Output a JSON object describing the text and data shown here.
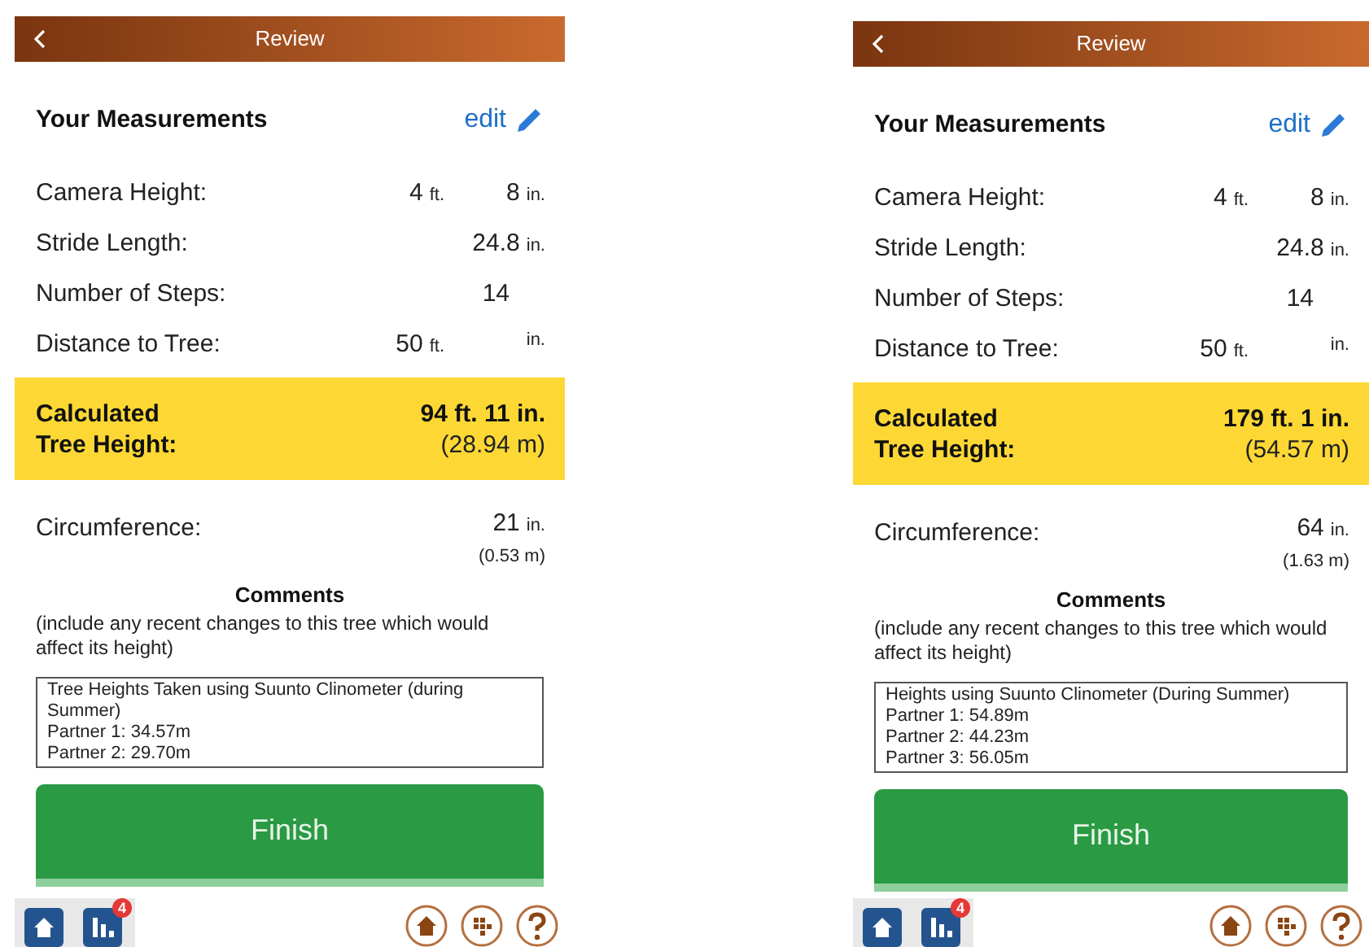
{
  "screens": [
    {
      "title": "Review",
      "heading": "Your Measurements",
      "edit_label": "edit",
      "measurements": [
        {
          "label": "Camera Height:",
          "values": [
            {
              "number": "4",
              "unit": "ft."
            },
            {
              "number": "8",
              "unit": "in."
            }
          ]
        },
        {
          "label": "Stride Length:",
          "values": [
            {
              "number": "24.8",
              "unit": "in."
            }
          ]
        },
        {
          "label": "Number of Steps:",
          "values": [
            {
              "number": "14"
            }
          ]
        },
        {
          "label": "Distance to Tree:",
          "values": [
            {
              "number": "50",
              "unit": "ft."
            },
            {
              "unit": "in."
            }
          ]
        }
      ],
      "calculated": {
        "label": "Calculated Tree Height:",
        "imperial": "94 ft. 11 in.",
        "metric": "(28.94 m)"
      },
      "circumference": {
        "label": "Circumference:",
        "number": "21",
        "unit": "in.",
        "metric": "(0.53 m)"
      },
      "comments": {
        "title": "Comments",
        "hint": "(include any recent changes to this tree which would affect its height)",
        "lines": [
          "Tree Heights Taken using Suunto Clinometer (during Summer)",
          "Partner 1: 34.57m",
          "Partner 2: 29.70m"
        ]
      },
      "finish_label": "Finish",
      "badge": "4"
    },
    {
      "title": "Review",
      "heading": "Your Measurements",
      "edit_label": "edit",
      "measurements": [
        {
          "label": "Camera Height:",
          "values": [
            {
              "number": "4",
              "unit": "ft."
            },
            {
              "number": "8",
              "unit": "in."
            }
          ]
        },
        {
          "label": "Stride Length:",
          "values": [
            {
              "number": "24.8",
              "unit": "in."
            }
          ]
        },
        {
          "label": "Number of Steps:",
          "values": [
            {
              "number": "14"
            }
          ]
        },
        {
          "label": "Distance to Tree:",
          "values": [
            {
              "number": "50",
              "unit": "ft."
            },
            {
              "unit": "in."
            }
          ]
        }
      ],
      "calculated": {
        "label": "Calculated Tree Height:",
        "imperial": "179 ft. 1 in.",
        "metric": "(54.57 m)"
      },
      "circumference": {
        "label": "Circumference:",
        "number": "64",
        "unit": "in.",
        "metric": "(1.63 m)"
      },
      "comments": {
        "title": "Comments",
        "hint": "(include any recent changes to this tree which would affect its height)",
        "lines": [
          "Heights using Suunto Clinometer (During Summer)",
          "Partner 1: 54.89m",
          "Partner 2: 44.23m",
          "Partner 3: 56.05m"
        ]
      },
      "finish_label": "Finish",
      "badge": "4"
    }
  ]
}
